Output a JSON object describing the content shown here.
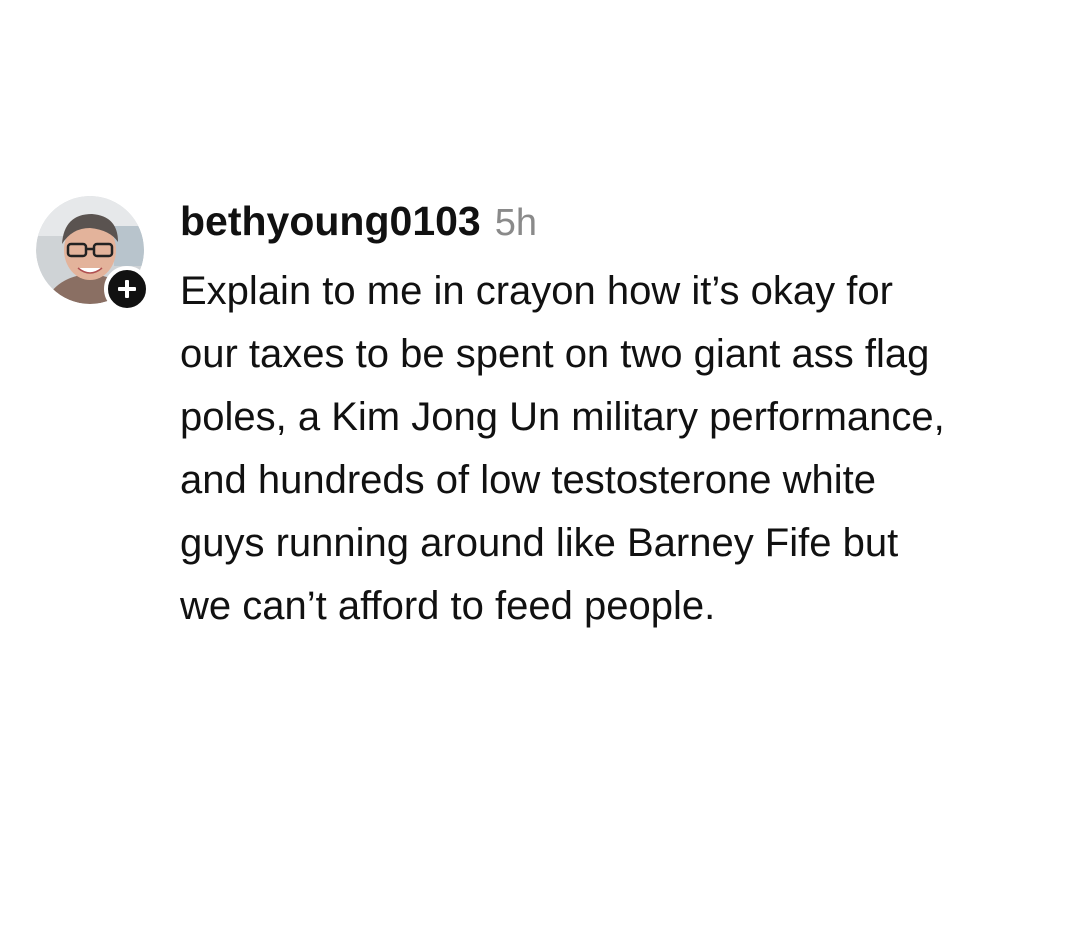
{
  "comment": {
    "username": "bethyoung0103",
    "timestamp": "5h",
    "text": "Explain to me in crayon how it’s okay for\nour taxes to be spent on two giant ass flag\npoles, a Kim Jong Un military performance,\nand hundreds of low testosterone white\nguys running around like Barney Fife but\nwe can’t afford to feed people.",
    "avatar_icon": "user-photo-avatar",
    "follow_icon": "plus-icon"
  }
}
